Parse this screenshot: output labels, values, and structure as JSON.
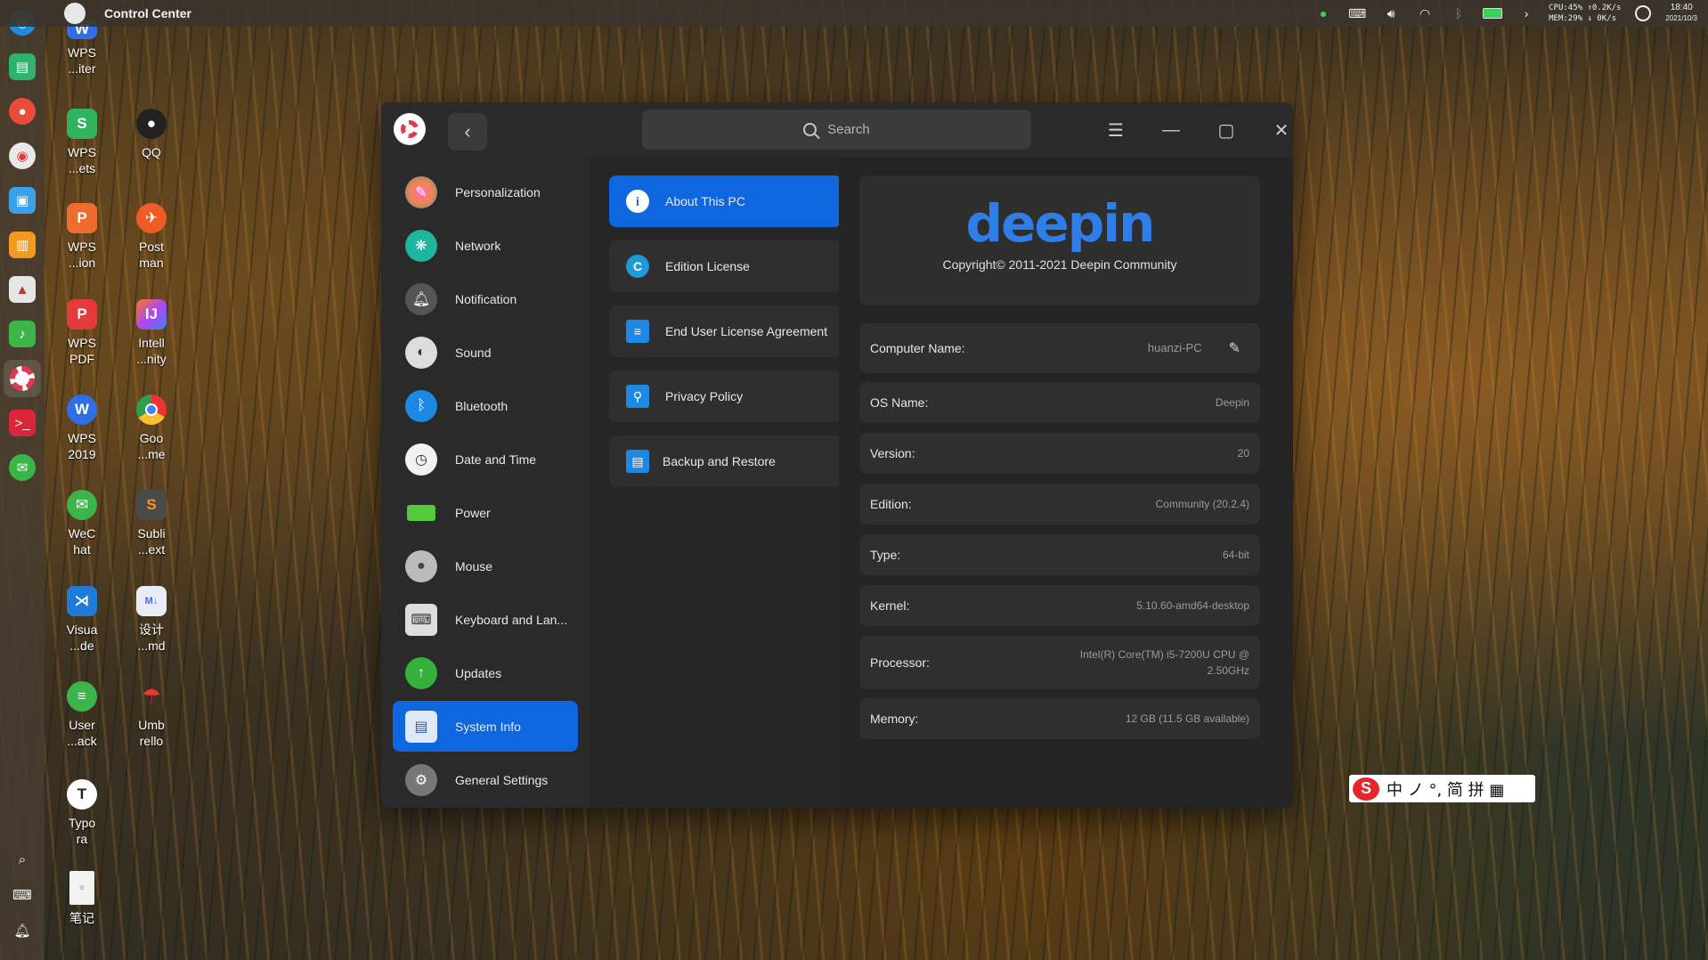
{
  "topbar": {
    "title": "Control Center",
    "stats_line1": "CPU:45% ↑0.2K/s",
    "stats_line2": "MEM:29% ↓  0K/s",
    "time": "18:40",
    "date": "2021/10/3"
  },
  "desktop_icons": [
    {
      "label": "WPS\n...iter",
      "col": 0
    },
    {
      "label": "WPS\n...ets"
    },
    {
      "label": "QQ"
    },
    {
      "label": "WPS\n...ion"
    },
    {
      "label": "Post\nman"
    },
    {
      "label": "WPS\nPDF"
    },
    {
      "label": "Intell\n...nity"
    },
    {
      "label": "WPS\n2019"
    },
    {
      "label": "Goo\n...me"
    },
    {
      "label": "WeC\nhat"
    },
    {
      "label": "Subli\n...ext"
    },
    {
      "label": "Visua\n...de"
    },
    {
      "label": "设计\n...md"
    },
    {
      "label": "User\n...ack"
    },
    {
      "label": "Umb\nrello"
    },
    {
      "label": "Typo\nra"
    },
    {
      "label": "笔记"
    }
  ],
  "window": {
    "search_placeholder": "Search",
    "nav": [
      {
        "label": "Personalization"
      },
      {
        "label": "Network"
      },
      {
        "label": "Notification"
      },
      {
        "label": "Sound"
      },
      {
        "label": "Bluetooth"
      },
      {
        "label": "Date and Time"
      },
      {
        "label": "Power"
      },
      {
        "label": "Mouse"
      },
      {
        "label": "Keyboard and Lan..."
      },
      {
        "label": "Updates"
      },
      {
        "label": "System Info"
      },
      {
        "label": "General Settings"
      }
    ],
    "sub": [
      {
        "label": "About This PC"
      },
      {
        "label": "Edition License"
      },
      {
        "label": "End User License Agreement"
      },
      {
        "label": "Privacy Policy"
      },
      {
        "label": "Backup and Restore"
      }
    ],
    "brand": {
      "logo": "deepin",
      "copyright": "Copyright© 2011-2021 Deepin Community"
    },
    "info": {
      "computer_name_label": "Computer Name:",
      "computer_name_value": "huanzi-PC",
      "os_label": "OS Name:",
      "os_value": "Deepin",
      "version_label": "Version:",
      "version_value": "20",
      "edition_label": "Edition:",
      "edition_value": "Community (20.2.4)",
      "type_label": "Type:",
      "type_value": "64-bit",
      "kernel_label": "Kernel:",
      "kernel_value": "5.10.60-amd64-desktop",
      "processor_label": "Processor:",
      "processor_value_1": "Intel(R) Core(TM) i5-7200U CPU @",
      "processor_value_2": "2.50GHz",
      "memory_label": "Memory:",
      "memory_value": "12 GB (11.5 GB available)"
    }
  },
  "ime": {
    "logo": "S",
    "glyphs": "中 ノ °, 简 拼 ▦"
  },
  "colors": {
    "accent": "#0f67e0",
    "window_bg": "#242424"
  }
}
